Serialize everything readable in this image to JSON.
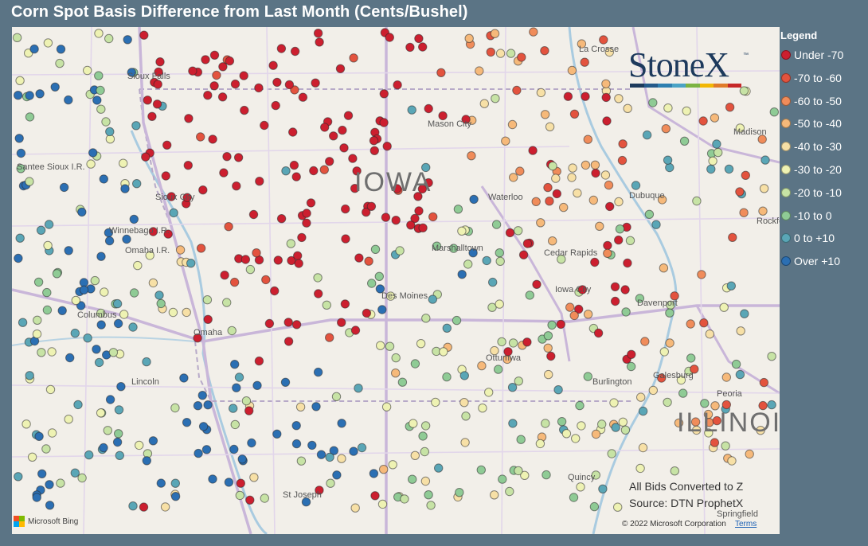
{
  "title": "Corn Spot Basis Difference from Last Month (Cents/Bushel)",
  "legend": {
    "title": "Legend",
    "items": [
      {
        "label": "Under -70",
        "color": "#cc1f2f"
      },
      {
        "label": "-70 to -60",
        "color": "#e3533e"
      },
      {
        "label": "-60 to -50",
        "color": "#f08c5a"
      },
      {
        "label": "-50 to -40",
        "color": "#f6b97a"
      },
      {
        "label": "-40 to -30",
        "color": "#f7e0a6"
      },
      {
        "label": "-30 to -20",
        "color": "#eef2b3"
      },
      {
        "label": "-20 to -10",
        "color": "#c7e3a5"
      },
      {
        "label": "-10 to 0",
        "color": "#8fcb95"
      },
      {
        "label": "0 to +10",
        "color": "#5aa6b6"
      },
      {
        "label": "Over +10",
        "color": "#2b6fb3"
      }
    ]
  },
  "logo": {
    "text": "StoneX",
    "tm": "™",
    "bar_colors": [
      "#1d3a5c",
      "#245a8a",
      "#2e7fb0",
      "#4aa3c5",
      "#7cb342",
      "#f2b705",
      "#e07b2a",
      "#c62828"
    ]
  },
  "notes": {
    "line1": "All Bids Converted to Z",
    "line2": "Source: DTN ProphetX"
  },
  "map_footer": {
    "copyright": "© 2022 Microsoft Corporation",
    "terms": "Terms",
    "bing": "Microsoft Bing"
  },
  "places": [
    "Sioux Falls",
    "Sioux City",
    "Omaha",
    "Columbus",
    "Lincoln",
    "St Joseph",
    "Mason City",
    "Waterloo",
    "Cedar Rapids",
    "Marshalltown",
    "Des Moines",
    "Iowa City",
    "Ottumwa",
    "Burlington",
    "Davenport",
    "Dubuque",
    "Galesburg",
    "Peoria",
    "Quincy",
    "La Crosse",
    "Madison",
    "Rockford",
    "Springfield",
    "Santee Sioux I.R.",
    "Winnebago I.R.",
    "Omaha I.R."
  ],
  "states": [
    "IOWA",
    "ILLINOIS"
  ],
  "sample_counts": {
    "Under -70": 220,
    "-70 to -60": 35,
    "-60 to -50": 30,
    "-50 to -40": 30,
    "-40 to -30": 35,
    "-30 to -20": 40,
    "-20 to -10": 70,
    "-10 to 0": 60,
    "0 to +10": 60,
    "Over +10": 90
  }
}
